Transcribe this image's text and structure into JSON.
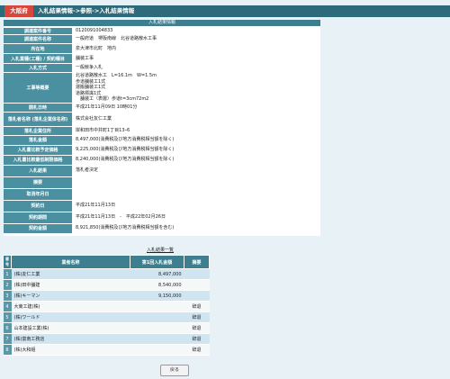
{
  "header": {
    "pref_label": "大阪府",
    "breadcrumb": "入札結果情報->参照->入札結果情報"
  },
  "info": {
    "title": "入札結果情報",
    "rows": [
      {
        "label": "調達案件番号",
        "value": "0120091004833"
      },
      {
        "label": "調達案件名称",
        "value": "一般府道　堺阪南線　北谷道路散水工事"
      },
      {
        "label": "所在地",
        "value": "泉大津市北町　地内"
      },
      {
        "label": "入札業種(工種) / 契約種目",
        "value": "舗装工事"
      },
      {
        "label": "入札方式",
        "value": "一般競争入札"
      },
      {
        "label": "工事等概要",
        "value": "北谷道路散水工　L=16.1m　W=1.5m\n歩道舗装工1式\n運搬舗装工1式\n道路標識1式\n　舗装工（表層）歩道t=3cm72m2"
      },
      {
        "label": "開札日時",
        "value": "平成21年11月09日 10時01分"
      },
      {
        "label": "落札者名称 (落札企業体名称)",
        "value": "株式会社友仁工業"
      },
      {
        "label": "落札企業住所",
        "value": "岸和田市中井町1丁目13ｰ6"
      },
      {
        "label": "落札金額",
        "value": "8,497,000(消費税及び地方消費税相当額を除く)"
      },
      {
        "label": "入札書比較予定価格",
        "value": "9,225,000(消費税及び地方消費税相当額を除く)"
      },
      {
        "label": "入札書比較最低制限価格",
        "value": "8,240,000(消費税及び地方消費税相当額を除く)"
      },
      {
        "label": "入札結果",
        "value": "落札者決定"
      },
      {
        "label": "摘要",
        "value": ""
      },
      {
        "label": "取消年月日",
        "value": ""
      },
      {
        "label": "契約日",
        "value": "平成21年11月13日"
      },
      {
        "label": "契約期間",
        "value": "平成21年11月13日　-　平成22年02月26日"
      },
      {
        "label": "契約金額",
        "value": "8,921,850(消費税及び地方消費税相当額を含む)"
      }
    ]
  },
  "list": {
    "title": "入札結果一覧",
    "headers": {
      "num": "番号",
      "name": "業者名称",
      "amount": "第1回入札金額",
      "remark": "摘要"
    },
    "rows": [
      {
        "num": "1",
        "name": "(株)友仁工業",
        "amount": "8,497,000",
        "remark": ""
      },
      {
        "num": "2",
        "name": "(株)田中舗建",
        "amount": "8,540,000",
        "remark": ""
      },
      {
        "num": "3",
        "name": "(株)キーマン",
        "amount": "9,150,000",
        "remark": ""
      },
      {
        "num": "4",
        "name": "大東工建(株)",
        "amount": "",
        "remark": "辞退"
      },
      {
        "num": "5",
        "name": "(株)ワールド",
        "amount": "",
        "remark": "辞退"
      },
      {
        "num": "6",
        "name": "山本建設工業(株)",
        "amount": "",
        "remark": "辞退"
      },
      {
        "num": "7",
        "name": "(株)富南工務店",
        "amount": "",
        "remark": "辞退"
      },
      {
        "num": "8",
        "name": "(株)大和組",
        "amount": "",
        "remark": "辞退"
      }
    ]
  },
  "buttons": {
    "back": "戻る"
  },
  "colors": {
    "header_bg": "#2d6a7a",
    "pref_badge": "#d8473d",
    "label_cell": "#4a90a0",
    "row_highlight": "#cfe6f2"
  }
}
